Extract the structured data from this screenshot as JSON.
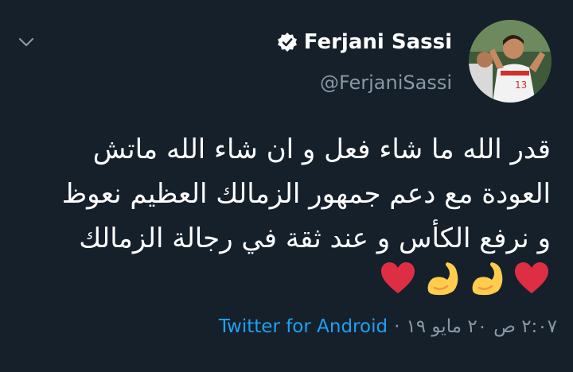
{
  "user": {
    "name": "Ferjani Sassi",
    "handle": "@FerjaniSassi",
    "jersey_number": "13"
  },
  "tweet": {
    "lines": [
      "قدر الله ما شاء فعل و ان شاء الله ماتش",
      "العودة مع دعم جمهور الزمالك العظيم نعوظ",
      "و نرفع الكأس و عند ثقة في رجالة الزمالك"
    ],
    "emojis": [
      "red-heart",
      "flexed-biceps",
      "flexed-biceps",
      "red-heart"
    ]
  },
  "meta": {
    "time": "٢:٠٧ ص",
    "separator1": "·",
    "date": "٢٠ مايو ١٩",
    "separator2": "·",
    "source": "Twitter for Android"
  },
  "colors": {
    "background": "#15202b",
    "secondary_text": "#8899a6",
    "link": "#1da1f2"
  }
}
